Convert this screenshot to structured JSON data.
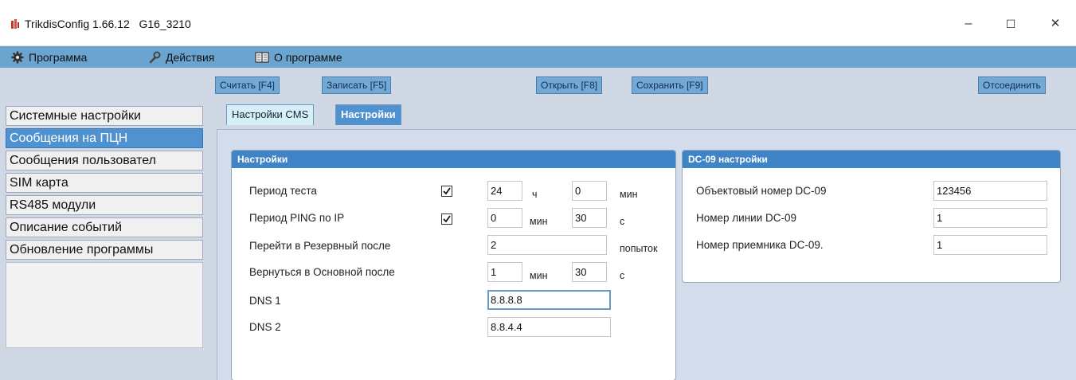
{
  "window": {
    "title": "TrikdisConfig 1.66.12   G16_3210",
    "minimize": "–",
    "maximize": "☐",
    "close": "✕"
  },
  "menu": {
    "program": "Программа",
    "actions": "Действия",
    "about": "О программе"
  },
  "toolbar": {
    "read": "Считать [F4]",
    "write": "Записать [F5]",
    "open": "Открыть [F8]",
    "save": "Сохранить [F9]",
    "disconnect": "Отсоединить"
  },
  "sidebar": {
    "items": [
      "Системные настройки",
      "Сообщения на ПЦН",
      "Сообщения пользовател",
      "SIM карта",
      "RS485 модули",
      "Описание событий",
      "Обновление программы"
    ],
    "active_index": 1
  },
  "tabs": [
    "Настройки CMS",
    "Настройки"
  ],
  "settings": {
    "title": "Настройки",
    "test_period": {
      "label": "Период теста",
      "checked": true,
      "hours": "24",
      "hours_unit": "ч",
      "minutes": "0",
      "minutes_unit": "мин"
    },
    "ping_period": {
      "label": "Период PING по IP",
      "checked": true,
      "minutes": "0",
      "minutes_unit": "мин",
      "seconds": "30",
      "seconds_unit": "с"
    },
    "backup_after": {
      "label": "Перейти в Резервный после",
      "value": "2",
      "unit": "попыток"
    },
    "primary_after": {
      "label": "Вернуться в Основной после",
      "minutes": "1",
      "minutes_unit": "мин",
      "seconds": "30",
      "seconds_unit": "с"
    },
    "dns1": {
      "label": "DNS 1",
      "value": "8.8.8.8"
    },
    "dns2": {
      "label": "DNS 2",
      "value": "8.8.4.4"
    }
  },
  "dc09": {
    "title": "DC-09 настройки",
    "object_number": {
      "label": "Объектовый номер DC-09",
      "value": "123456"
    },
    "line_number": {
      "label": "Номер линии DC-09",
      "value": "1"
    },
    "receiver_number": {
      "label": "Номер приемника DC-09.",
      "value": "1"
    }
  },
  "colors": {
    "menubar": "#6aa4cf",
    "active": "#4f92cf",
    "group_header": "#3f84c6"
  }
}
